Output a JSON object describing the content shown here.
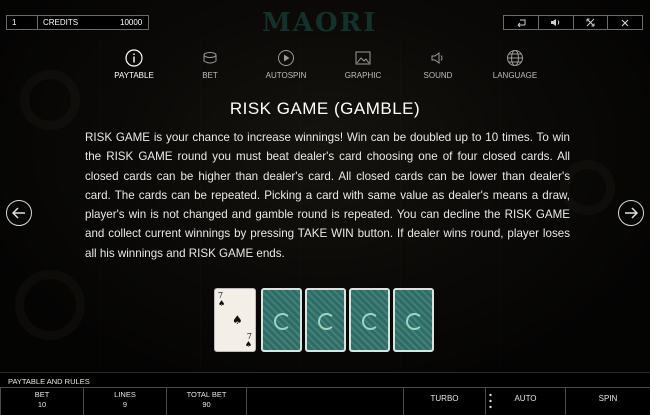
{
  "top": {
    "line_value": "1",
    "credits_label": "CREDITS",
    "credits_value": "10000",
    "logo": "MAORI"
  },
  "top_icons": [
    "back-icon",
    "sound-icon",
    "fullscreen-icon",
    "close-icon"
  ],
  "menu": [
    {
      "label": "PAYTABLE",
      "icon": "info-icon",
      "active": true
    },
    {
      "label": "BET",
      "icon": "coins-icon"
    },
    {
      "label": "AUTOSPIN",
      "icon": "play-icon"
    },
    {
      "label": "GRAPHIC",
      "icon": "image-icon"
    },
    {
      "label": "SOUND",
      "icon": "speaker-icon"
    },
    {
      "label": "LANGUAGE",
      "icon": "globe-icon"
    }
  ],
  "content": {
    "title": "RISK GAME (GAMBLE)",
    "body": "RISK GAME is your chance to increase winnings! Win can be doubled up to 10 times. To win the RISK GAME round you must beat dealer's card choosing one of four closed cards. All closed cards can be higher than dealer's card. All closed cards can be lower than dealer's card. The cards can be repeated. Picking a card with same value as dealer's means a draw, player's win is not changed and gamble round is repeated. You can decline the RISK GAME and collect current winnings by pressing TAKE WIN button. If dealer wins round, player loses all his winnings and RISK GAME ends."
  },
  "cards": {
    "dealer": {
      "rank": "7",
      "suit": "♠"
    },
    "closed_count": 4
  },
  "bottom": {
    "paytable_label": "PAYTABLE AND RULES",
    "bet_label": "BET",
    "bet_value": "10",
    "lines_label": "LINES",
    "lines_value": "9",
    "total_bet_label": "TOTAL BET",
    "total_bet_value": "90",
    "turbo_label": "TURBO",
    "auto_label": "AUTO",
    "spin_label": "SPIN"
  },
  "colors": {
    "accent_card_back": "#2c6d66",
    "text": "#ffffff"
  }
}
